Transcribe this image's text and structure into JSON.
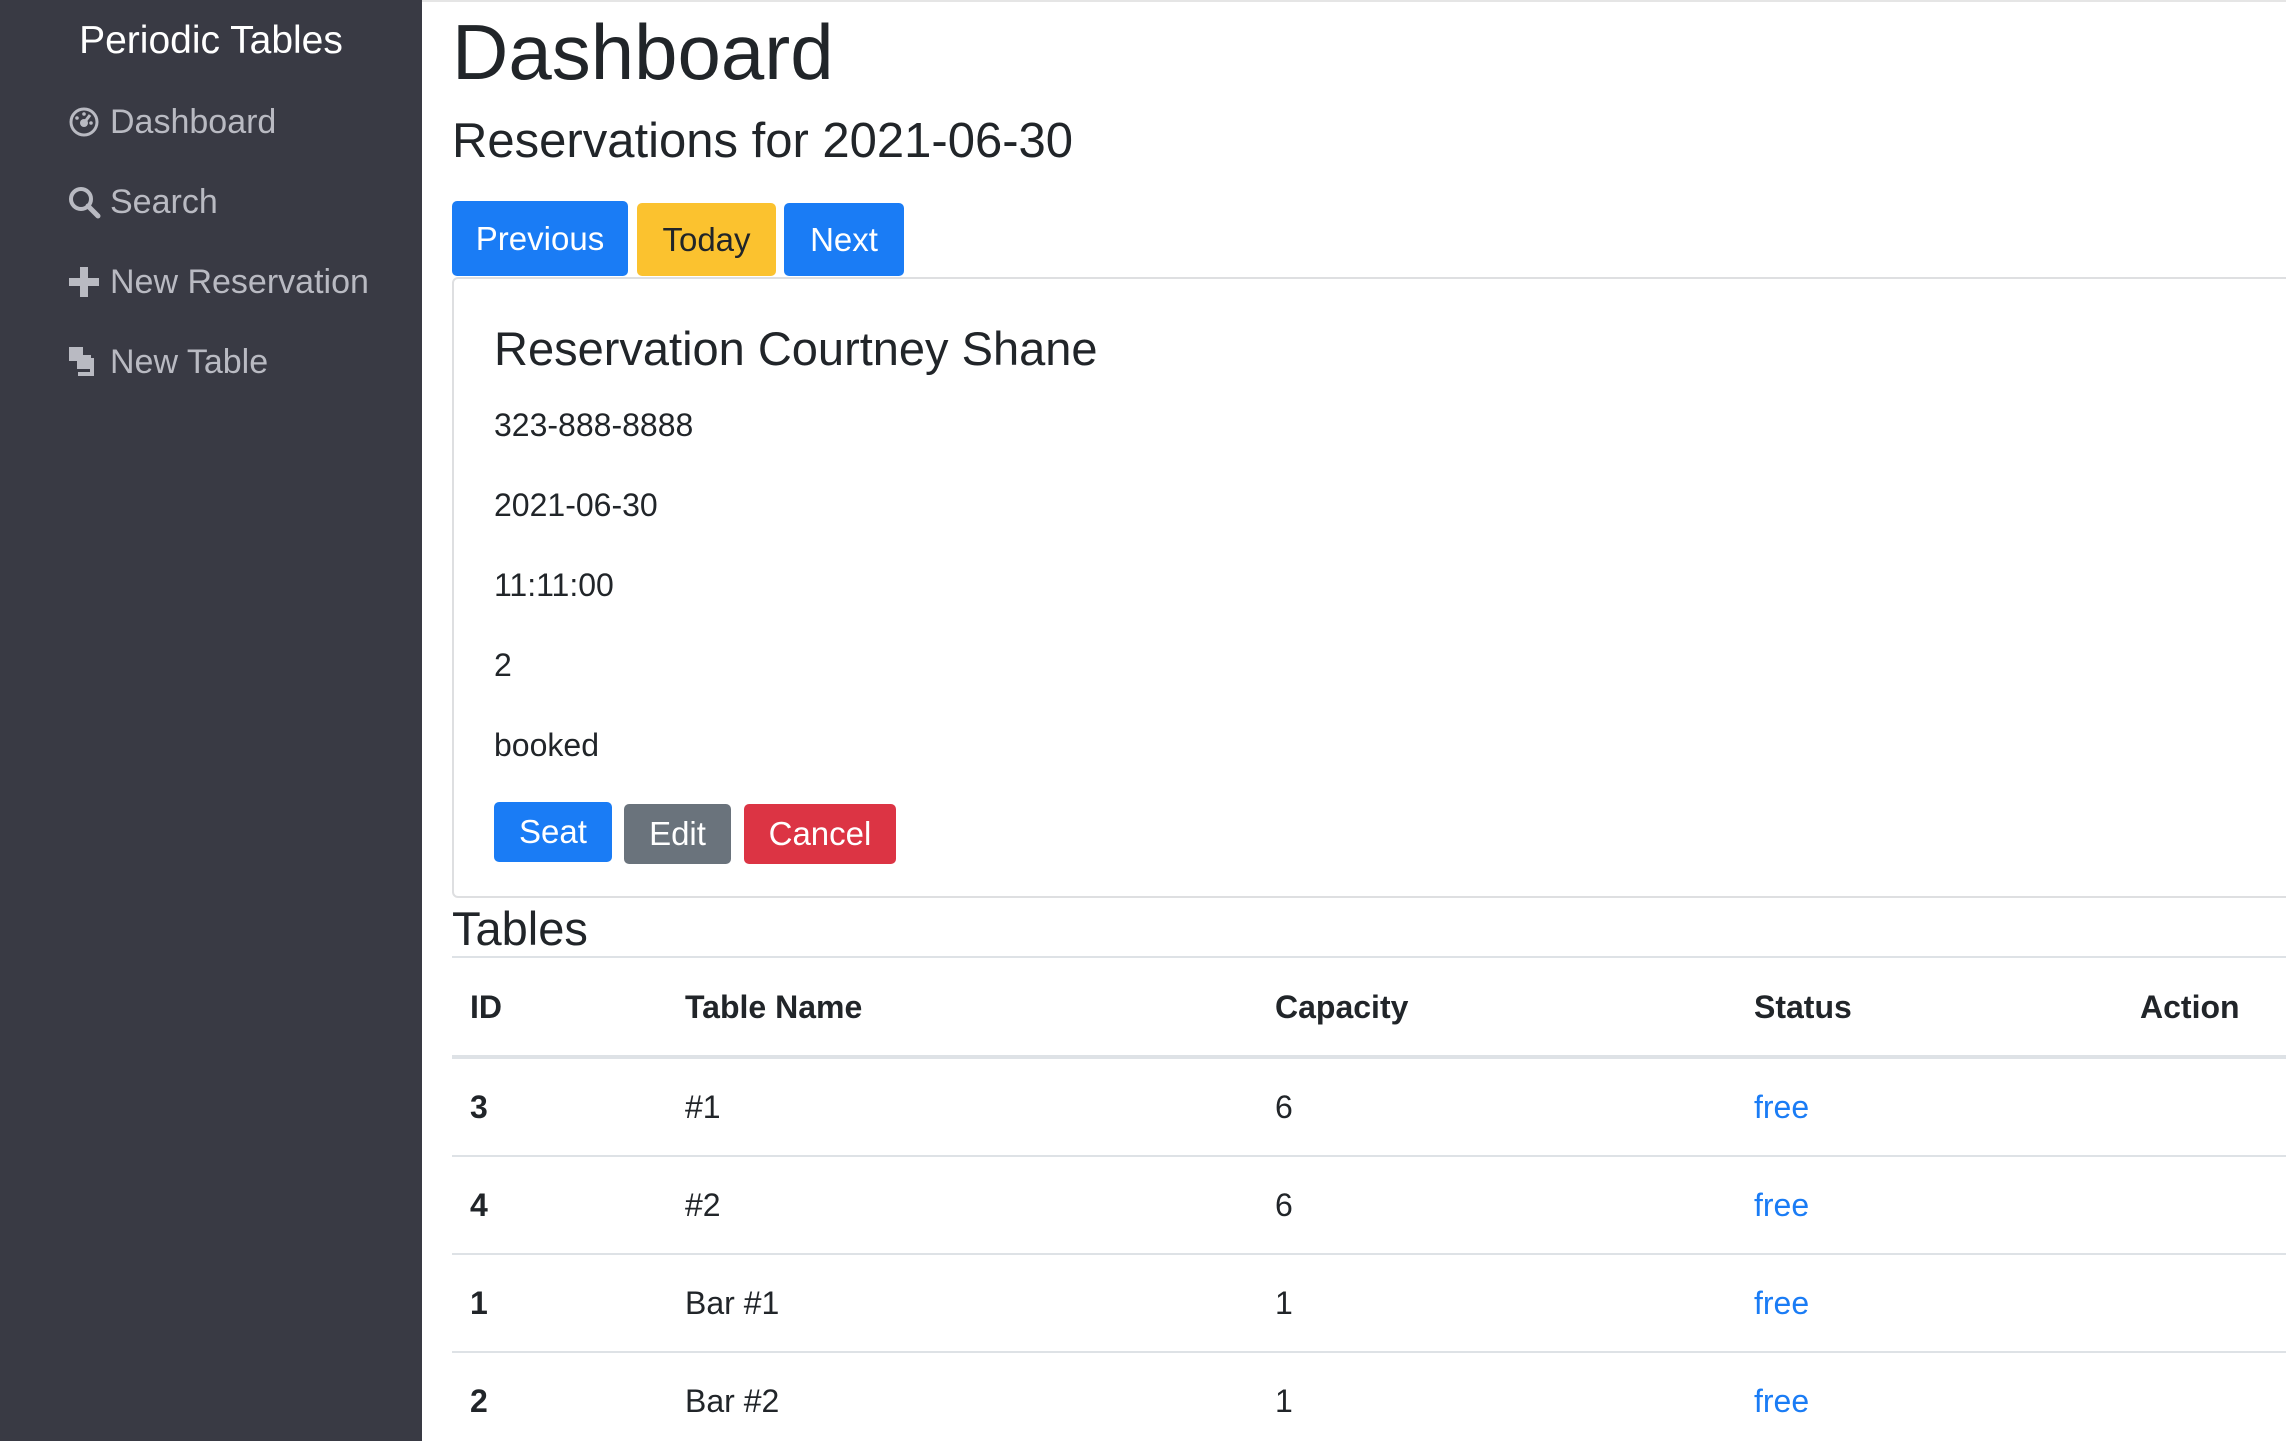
{
  "sidebar": {
    "brand": "Periodic Tables",
    "items": [
      {
        "label": "Dashboard",
        "icon": "dashboard-icon"
      },
      {
        "label": "Search",
        "icon": "search-icon"
      },
      {
        "label": "New Reservation",
        "icon": "plus-icon"
      },
      {
        "label": "New Table",
        "icon": "layers-icon"
      }
    ]
  },
  "main": {
    "title": "Dashboard",
    "subtitle": "Reservations for 2021-06-30",
    "date_nav": {
      "previous": "Previous",
      "today": "Today",
      "next": "Next"
    },
    "reservation": {
      "title": "Reservation Courtney Shane",
      "phone": "323-888-8888",
      "date": "2021-06-30",
      "time": "11:11:00",
      "people": "2",
      "status": "booked",
      "actions": {
        "seat": "Seat",
        "edit": "Edit",
        "cancel": "Cancel"
      }
    },
    "tables": {
      "heading": "Tables",
      "columns": [
        "ID",
        "Table Name",
        "Capacity",
        "Status",
        "Action"
      ],
      "rows": [
        {
          "id": "3",
          "name": "#1",
          "capacity": "6",
          "status": "free"
        },
        {
          "id": "4",
          "name": "#2",
          "capacity": "6",
          "status": "free"
        },
        {
          "id": "1",
          "name": "Bar #1",
          "capacity": "1",
          "status": "free"
        },
        {
          "id": "2",
          "name": "Bar #2",
          "capacity": "1",
          "status": "free"
        }
      ]
    }
  },
  "colors": {
    "sidebar_bg": "#393a44",
    "primary": "#1a7cf5",
    "warning": "#fbc22f",
    "secondary": "#6a737c",
    "danger": "#dc3444"
  }
}
